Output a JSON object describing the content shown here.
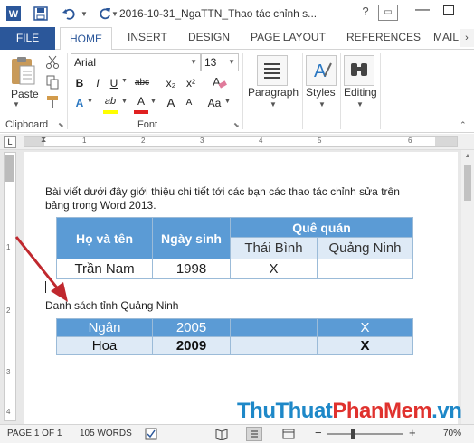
{
  "window": {
    "title": "2016-10-31_NgaTTN_Thao tác chỉnh s...",
    "help": "?"
  },
  "tabs": {
    "file": "FILE",
    "items": [
      "HOME",
      "INSERT",
      "DESIGN",
      "PAGE LAYOUT",
      "REFERENCES",
      "MAILI"
    ]
  },
  "ribbon": {
    "paste_label": "Paste",
    "clipboard_label": "Clipboard",
    "font_name": "Arial",
    "font_size": "13",
    "font_label": "Font",
    "bold": "B",
    "italic": "I",
    "underline": "U",
    "strike": "abc",
    "subscript": "x₂",
    "superscript": "x²",
    "text_effects": "A",
    "highlight": "ab",
    "font_color": "A",
    "grow": "A",
    "shrink": "A",
    "change_case": "Aa",
    "paragraph": "Paragraph",
    "styles": "Styles",
    "editing": "Editing"
  },
  "ruler": {
    "numbers": [
      "1",
      "2",
      "3",
      "4",
      "5",
      "6"
    ],
    "vertical_numbers": [
      "1",
      "2",
      "3",
      "4"
    ]
  },
  "document": {
    "intro": "Bài viết dưới đây giới thiệu chi tiết tới các bạn các thao tác chỉnh sửa trên bảng trong Word 2013.",
    "table1": {
      "h_name": "Họ và tên",
      "h_dob": "Ngày sinh",
      "h_home": "Quê quán",
      "h_thaibinh": "Thái Bình",
      "h_quangninh": "Quảng Ninh",
      "row": {
        "name": "Trần Nam",
        "year": "1998",
        "thaibinh": "X",
        "quangninh": ""
      }
    },
    "caption": "Danh sách tỉnh Quảng Ninh",
    "table2": {
      "rows": [
        {
          "name": "Ngân",
          "year": "2005",
          "c3": "",
          "c4": "X"
        },
        {
          "name": "Hoa",
          "year": "2009",
          "c3": "",
          "c4": "X"
        }
      ]
    }
  },
  "status": {
    "page": "PAGE 1 OF 1",
    "words": "105 WORDS",
    "zoom_out": "−",
    "zoom_in": "+",
    "zoom": "70%"
  },
  "watermark": {
    "part1": "ThuThuat",
    "part2": "PhanMem",
    "part3": ".vn"
  },
  "colors": {
    "accent": "#2b579a",
    "table_header": "#5b9bd5",
    "table_light": "#deeaf6",
    "arrow": "#c0282e",
    "watermark_blue": "#1e88c8",
    "watermark_red": "#e0322e"
  }
}
